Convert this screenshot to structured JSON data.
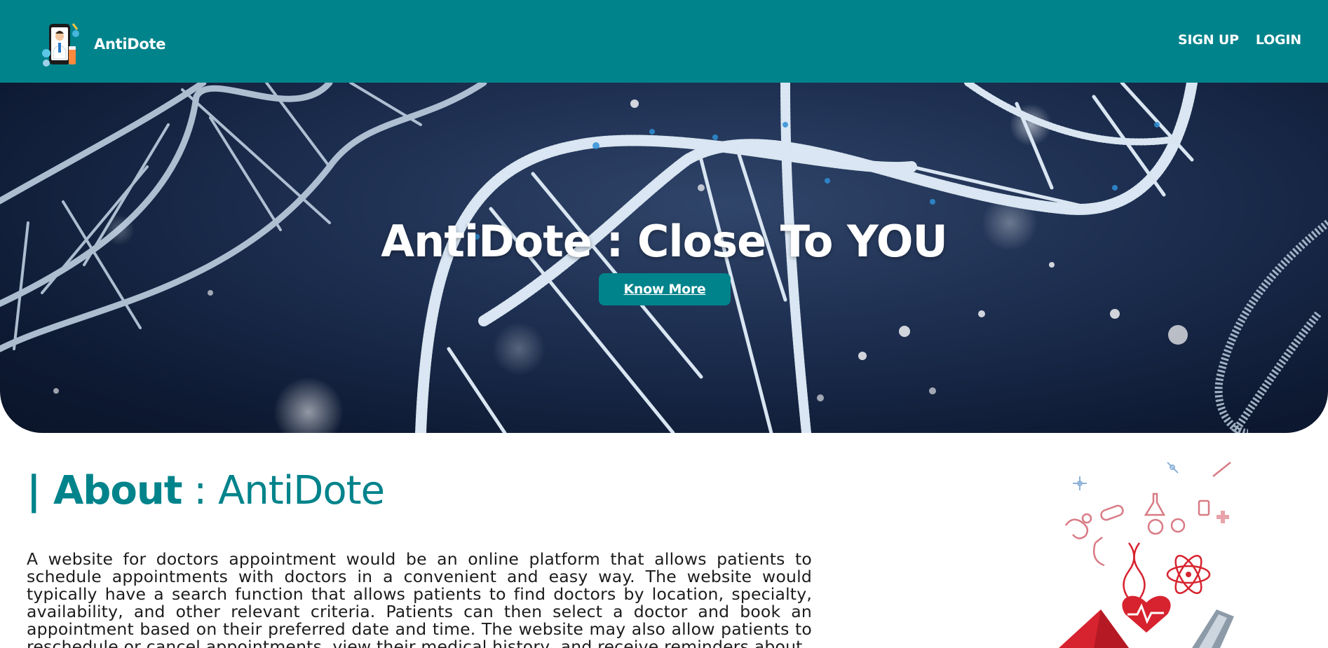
{
  "header": {
    "brand": "AntiDote",
    "nav": [
      {
        "label": "SIGN UP"
      },
      {
        "label": "LOGIN"
      }
    ]
  },
  "hero": {
    "title": "AntiDote : Close To YOU",
    "button_label": "Know More"
  },
  "about": {
    "bar": "|",
    "title_bold": "About",
    "separator": " : ",
    "title_light": "AntiDote",
    "text": "A website for doctors appointment would be an online platform that allows patients to schedule appointments with doctors in a convenient and easy way. The website would typically have a search function that allows patients to find doctors by location, specialty, availability, and other relevant criteria. Patients can then select a doctor and book an appointment based on their preferred date and time. The website may also allow patients to reschedule or cancel appointments, view their medical history, and receive reminders about"
  },
  "colors": {
    "brand_teal": "#00838b",
    "hero_dark": "#0e1a33",
    "accent_red": "#d7232f"
  },
  "icons": [
    "doctor-app-logo-icon",
    "dna-helix-background",
    "medical-icons-illustration"
  ]
}
